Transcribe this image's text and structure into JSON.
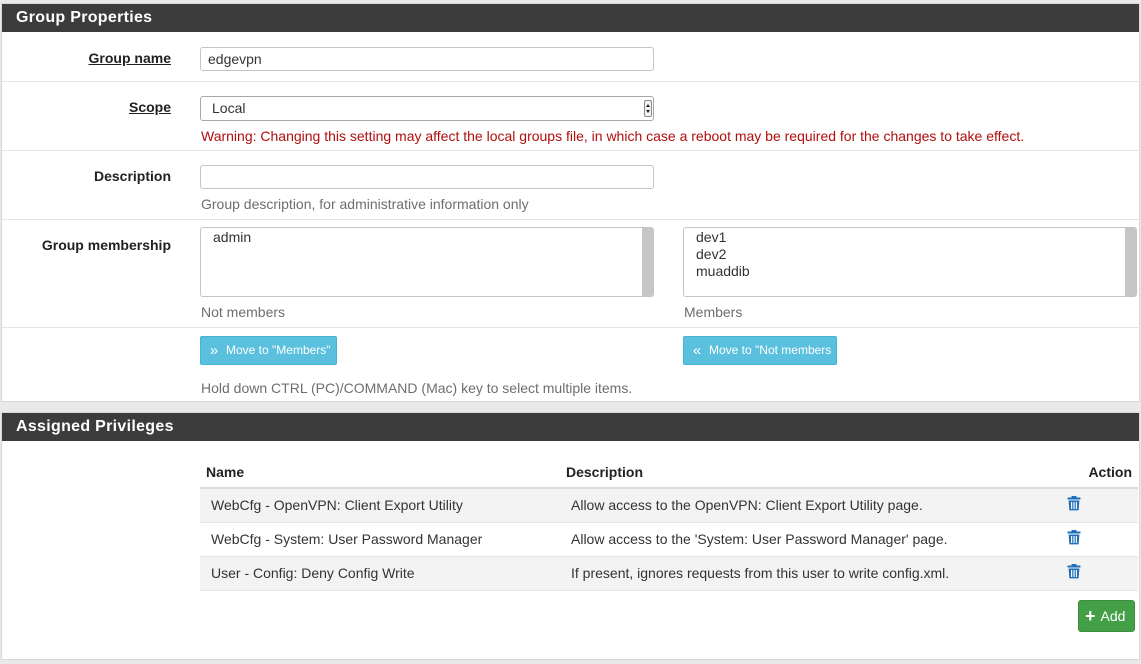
{
  "group_properties": {
    "heading": "Group Properties",
    "group_name": {
      "label": "Group name",
      "value": "edgevpn"
    },
    "scope": {
      "label": "Scope",
      "selected": "Local",
      "warning": "Warning: Changing this setting may affect the local groups file, in which case a reboot may be required for the changes to take effect."
    },
    "description": {
      "label": "Description",
      "value": "",
      "help": "Group description, for administrative information only"
    },
    "membership": {
      "label": "Group membership",
      "not_members": [
        "admin"
      ],
      "not_members_label": "Not members",
      "members": [
        "dev1",
        "dev2",
        "muaddib"
      ],
      "members_label": "Members",
      "move_to_members_label": "Move to \"Members\"",
      "move_to_not_members_label": "Move to \"Not members",
      "hint": "Hold down CTRL (PC)/COMMAND (Mac) key to select multiple items."
    }
  },
  "assigned_privileges": {
    "heading": "Assigned Privileges",
    "columns": {
      "name": "Name",
      "description": "Description",
      "action": "Action"
    },
    "rows": [
      {
        "name": "WebCfg - OpenVPN: Client Export Utility",
        "description": "Allow access to the OpenVPN: Client Export Utility page."
      },
      {
        "name": "WebCfg - System: User Password Manager",
        "description": "Allow access to the 'System: User Password Manager' page."
      },
      {
        "name": "User - Config: Deny Config Write",
        "description": "If present, ignores requests from this user to write config.xml."
      }
    ],
    "add_label": "Add"
  },
  "icons": {
    "move_right": "double-chevron-right-icon",
    "move_left": "double-chevron-left-icon",
    "delete": "trash-icon",
    "add": "plus-icon"
  },
  "colors": {
    "heading_bg": "#3c3c3c",
    "warning": "#b20e0e",
    "info_button": "#5bc0de",
    "success_button": "#43a047",
    "trash_icon": "#1e6fb8"
  }
}
